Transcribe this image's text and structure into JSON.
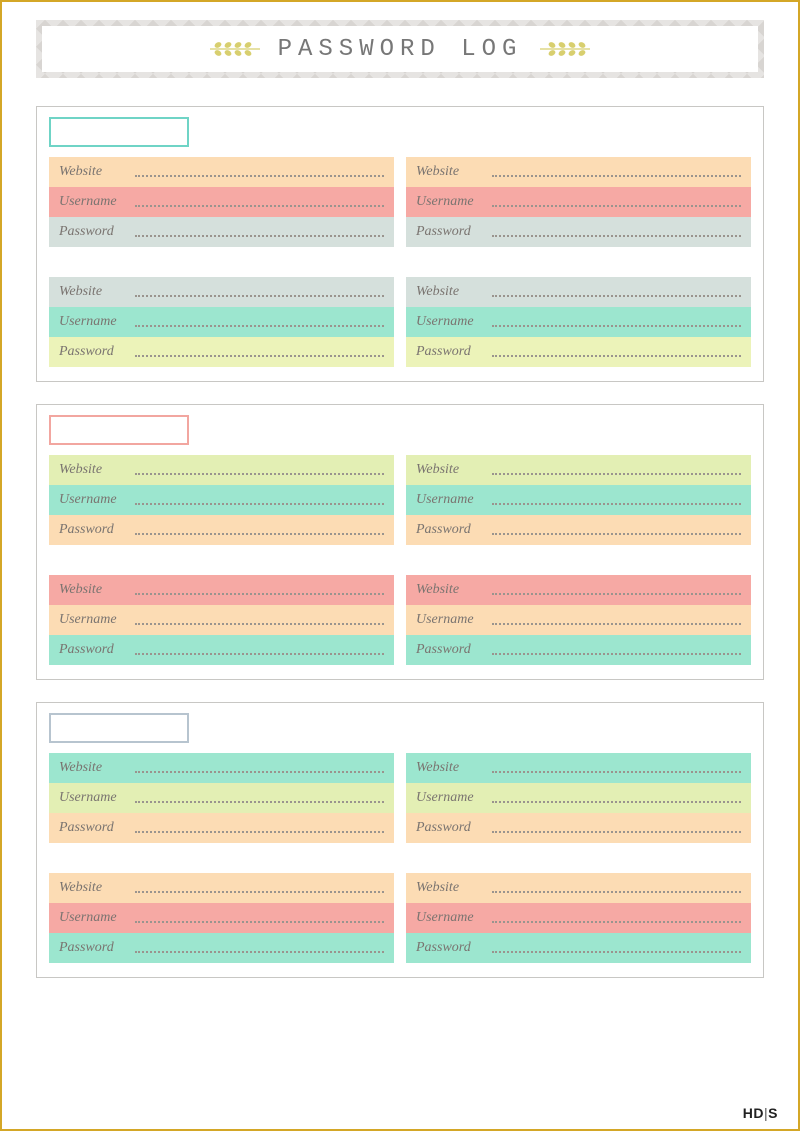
{
  "header": {
    "title": "Password Log"
  },
  "labels": {
    "website": "Website",
    "username": "Username",
    "password": "Password"
  },
  "sections": [
    {
      "category_border": "#6fd4c6",
      "blocks": [
        {
          "rows": [
            {
              "bg": "#fcdcb4"
            },
            {
              "bg": "#f6a9a4"
            },
            {
              "bg": "#d5e0dc"
            }
          ]
        },
        {
          "rows": [
            {
              "bg": "#d5e0dc"
            },
            {
              "bg": "#9ce6cf"
            },
            {
              "bg": "#ecf3b9"
            }
          ]
        }
      ]
    },
    {
      "category_border": "#f2a6a0",
      "blocks": [
        {
          "rows": [
            {
              "bg": "#e3efb4"
            },
            {
              "bg": "#9ce6cf"
            },
            {
              "bg": "#fcdcb4"
            }
          ]
        },
        {
          "rows": [
            {
              "bg": "#f6a9a4"
            },
            {
              "bg": "#fcdcb4"
            },
            {
              "bg": "#9ce6cf"
            }
          ]
        }
      ]
    },
    {
      "category_border": "#b7c4cf",
      "blocks": [
        {
          "rows": [
            {
              "bg": "#9ce6cf"
            },
            {
              "bg": "#e3efb4"
            },
            {
              "bg": "#fcdcb4"
            }
          ]
        },
        {
          "rows": [
            {
              "bg": "#fcdcb4"
            },
            {
              "bg": "#f6a9a4"
            },
            {
              "bg": "#9ce6cf"
            }
          ]
        }
      ]
    }
  ],
  "footer": {
    "brand": "HD|S"
  }
}
